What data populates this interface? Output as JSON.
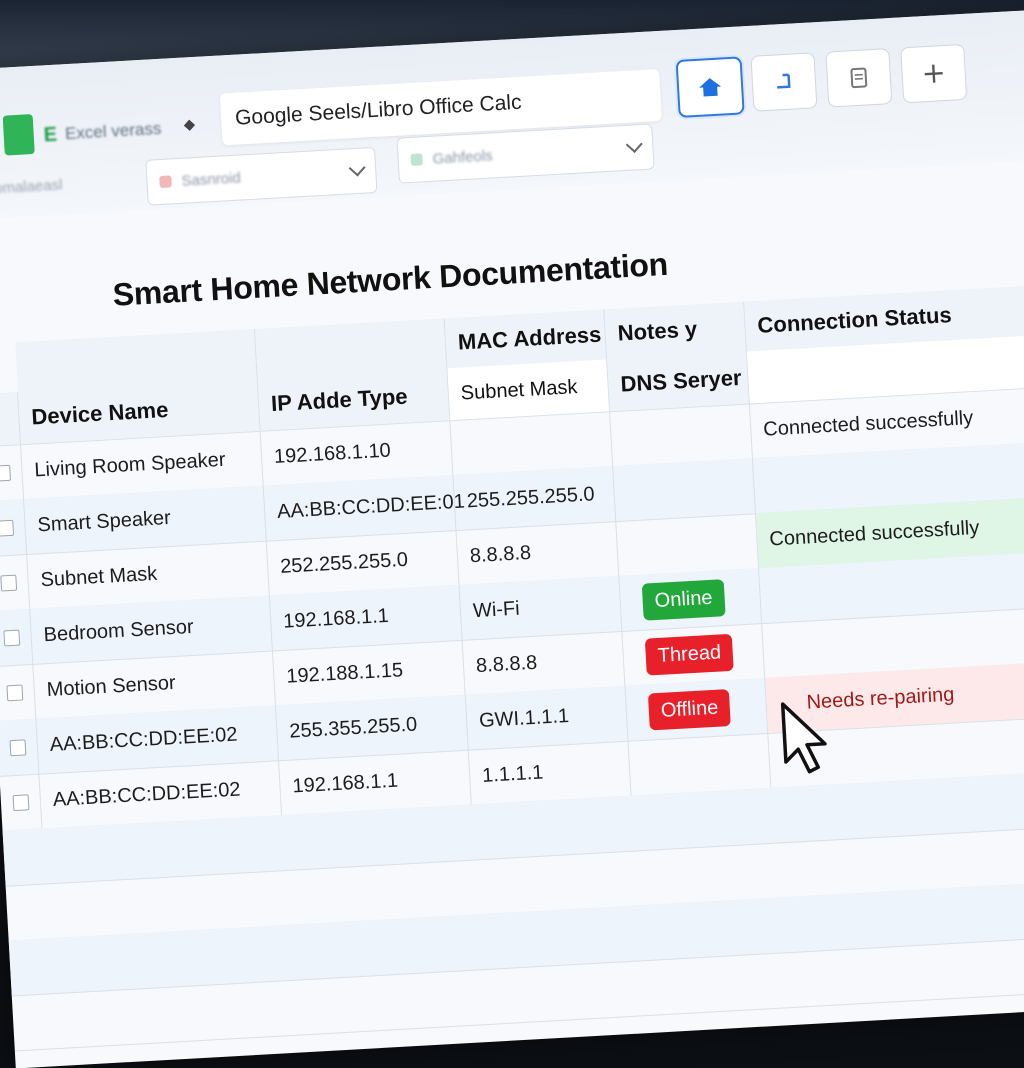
{
  "toolbar": {
    "excel_tab_label": "Excel verass",
    "app_title": "Google Seels/Libro Office Calc",
    "dropdown_left_label": "Sasnroid",
    "dropdown_left_sidebar": "Ilomalaeasl",
    "dropdown_right_label": "Gahfeols"
  },
  "doc": {
    "title": "Smart Home Network Documentation"
  },
  "table": {
    "headers": {
      "device_name": "Device Name",
      "ip_type": "IP Adde Type",
      "mac": "MAC Address",
      "notes": "Notes y",
      "connection_status": "Connection Status",
      "subnet_mask": "Subnet Mask",
      "dns_server": "DNS Seryer"
    },
    "rows": [
      {
        "device": "Living Room Speaker",
        "ip": "192.168.1.10",
        "mac": "",
        "status": "Connected successfully"
      },
      {
        "device": "Smart Speaker",
        "ip": "AA:BB:CC:DD:EE:01",
        "mac": "255.255.255.0",
        "status": ""
      },
      {
        "device": "Subnet Mask",
        "ip": "252.255.255.0",
        "mac": "8.8.8.8",
        "status": "Connected successfully"
      },
      {
        "device": "Bedroom Sensor",
        "ip": "192.168.1.1",
        "mac": "Wi-Fi",
        "notes_badge": "Online",
        "status": ""
      },
      {
        "device": "Motion Sensor",
        "ip": "192.188.1.15",
        "mac": "8.8.8.8",
        "notes_badge": "Thread",
        "status": ""
      },
      {
        "device": "AA:BB:CC:DD:EE:02",
        "ip": "255.355.255.0",
        "mac": "GWI.1.1.1",
        "notes_badge": "Offline",
        "status": "Needs re-pairing"
      },
      {
        "device": "AA:BB:CC:DD:EE:02",
        "ip": "192.168.1.1",
        "mac": "1.1.1.1",
        "status": ""
      }
    ]
  },
  "colors": {
    "online": "#22a83a",
    "thread": "#e8202a",
    "offline": "#e8202a",
    "accent": "#2f78e0"
  }
}
